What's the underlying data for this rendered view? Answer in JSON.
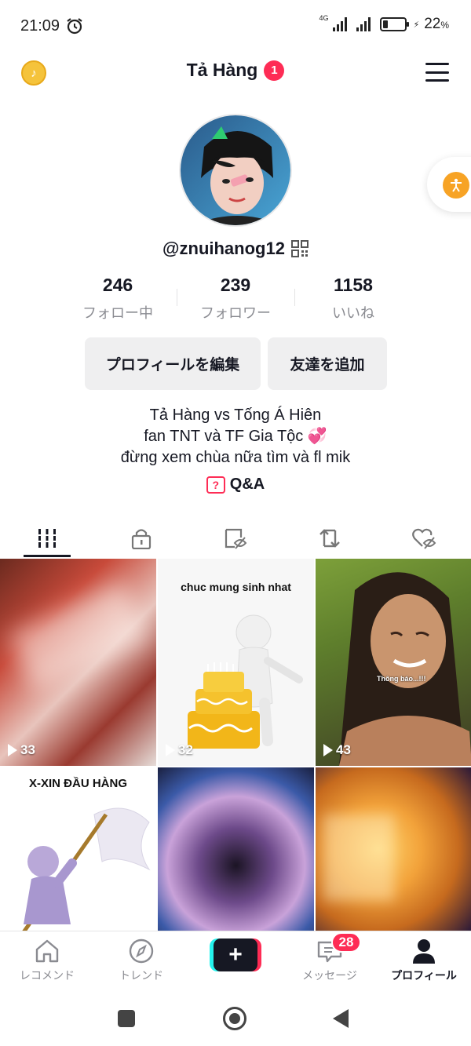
{
  "status_bar": {
    "time": "21:09",
    "network": "4G",
    "battery_percent": "22",
    "battery_unit": "%",
    "battery_level": 0.22
  },
  "header": {
    "title": "Tả Hàng",
    "badge_count": "1"
  },
  "profile": {
    "username": "@znuihanog12",
    "stats": [
      {
        "value": "246",
        "label": "フォロー中"
      },
      {
        "value": "239",
        "label": "フォロワー"
      },
      {
        "value": "1158",
        "label": "いいね"
      }
    ],
    "buttons": {
      "edit": "プロフィールを編集",
      "add_friend": "友達を追加"
    },
    "bio": [
      "Tả Hàng vs Tống Á Hiên",
      "fan TNT và TF Gia Tộc 💞",
      "đừng xem chùa nữa tìm và fl mik"
    ],
    "qa_label": "Q&A"
  },
  "videos": [
    {
      "views": "33"
    },
    {
      "views": "32",
      "caption": "chuc mung sinh nhat"
    },
    {
      "views": "43",
      "caption": "Thông báo...!!!"
    },
    {
      "caption": "X-XIN ĐẦU HÀNG"
    },
    {},
    {}
  ],
  "bottom_nav": {
    "items": [
      {
        "label": "レコメンド"
      },
      {
        "label": "トレンド"
      },
      {
        "label": ""
      },
      {
        "label": "メッセージ",
        "badge": "28"
      },
      {
        "label": "プロフィール"
      }
    ]
  },
  "colors": {
    "accent": "#fe2c55",
    "cyan": "#25f4ee",
    "text": "#161823",
    "muted": "#8a8b91"
  }
}
